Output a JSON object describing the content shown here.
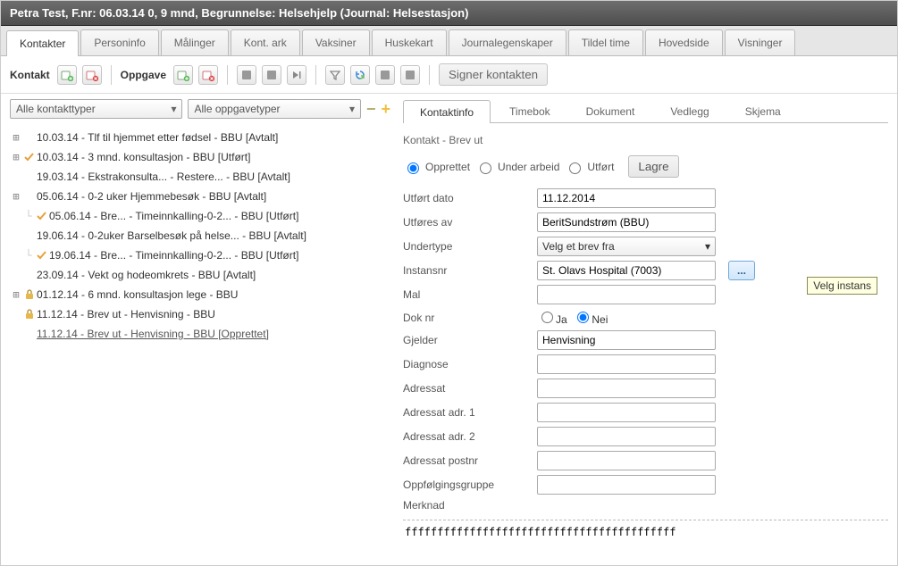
{
  "title": "Petra Test, F.nr: 06.03.14 0, 9 mnd, Begrunnelse: Helsehjelp (Journal: Helsestasjon)",
  "main_tabs": {
    "active": "Kontakter",
    "items": [
      "Kontakter",
      "Personinfo",
      "Målinger",
      "Kont. ark",
      "Vaksiner",
      "Huskekart",
      "Journalegenskaper",
      "Tildel time",
      "Hovedside",
      "Visninger"
    ]
  },
  "toolbar": {
    "contact_label": "Kontakt",
    "task_label": "Oppgave",
    "sign_label": "Signer kontakten"
  },
  "filters": {
    "contact_types": "Alle kontakttyper",
    "task_types": "Alle oppgavetyper"
  },
  "tree": [
    {
      "type": "exp",
      "icon": "",
      "text": "10.03.14 - Tlf til hjemmet etter fødsel - BBU [Avtalt]"
    },
    {
      "type": "exp",
      "icon": "check",
      "text": "10.03.14 - 3 mnd. konsultasjon - BBU [Utført]"
    },
    {
      "type": "node",
      "icon": "",
      "text": "19.03.14 - Ekstrakonsulta... - Restere... - BBU [Avtalt]"
    },
    {
      "type": "exp",
      "icon": "",
      "text": "05.06.14 - 0-2 uker Hjemmebesøk - BBU [Avtalt]"
    },
    {
      "type": "child",
      "icon": "check",
      "text": "05.06.14 - Bre... - Timeinnkalling-0-2... - BBU [Utført]"
    },
    {
      "type": "node",
      "icon": "",
      "text": "19.06.14 - 0-2uker Barselbesøk på helse... - BBU [Avtalt]"
    },
    {
      "type": "child",
      "icon": "check",
      "text": "19.06.14 - Bre... - Timeinnkalling-0-2... - BBU [Utført]"
    },
    {
      "type": "node",
      "icon": "",
      "text": "23.09.14 - Vekt og hodeomkrets - BBU [Avtalt]"
    },
    {
      "type": "exp",
      "icon": "lock",
      "text": "01.12.14 - 6 mnd. konsultasjon lege - BBU"
    },
    {
      "type": "node",
      "icon": "lock",
      "text": "11.12.14 - Brev ut - Henvisning - BBU"
    },
    {
      "type": "node",
      "icon": "",
      "text": "11.12.14 - Brev ut - Henvisning - BBU [Opprettet]",
      "selected": true
    }
  ],
  "subtabs": {
    "active": "Kontaktinfo",
    "items": [
      "Kontaktinfo",
      "Timebok",
      "Dokument",
      "Vedlegg",
      "Skjema"
    ]
  },
  "section_title": "Kontakt - Brev ut",
  "status": {
    "options": [
      "Opprettet",
      "Under arbeid",
      "Utført"
    ],
    "selected": "Opprettet",
    "save": "Lagre"
  },
  "form": {
    "utfort_dato": {
      "label": "Utført dato",
      "value": "11.12.2014"
    },
    "utfores_av": {
      "label": "Utføres av",
      "value": "BeritSundstrøm (BBU)"
    },
    "undertype": {
      "label": "Undertype",
      "value": "Velg et brev fra"
    },
    "instansnr": {
      "label": "Instansnr",
      "value": "St. Olavs Hospital (7003)"
    },
    "mal": {
      "label": "Mal",
      "value": ""
    },
    "dok_nr": {
      "label": "Dok nr",
      "ja": "Ja",
      "nei": "Nei",
      "selected": "Nei"
    },
    "gjelder": {
      "label": "Gjelder",
      "value": "Henvisning"
    },
    "diagnose": {
      "label": "Diagnose",
      "value": ""
    },
    "adressat": {
      "label": "Adressat",
      "value": ""
    },
    "adr1": {
      "label": "Adressat adr. 1",
      "value": ""
    },
    "adr2": {
      "label": "Adressat adr. 2",
      "value": ""
    },
    "postnr": {
      "label": "Adressat postnr",
      "value": ""
    },
    "oppfolging": {
      "label": "Oppfølgingsgruppe",
      "value": ""
    },
    "merknad": {
      "label": "Merknad",
      "value": "ffffffffffffffffffffffffffffffffffffffffff"
    }
  },
  "tooltip": "Velg instans",
  "instans_button": "..."
}
